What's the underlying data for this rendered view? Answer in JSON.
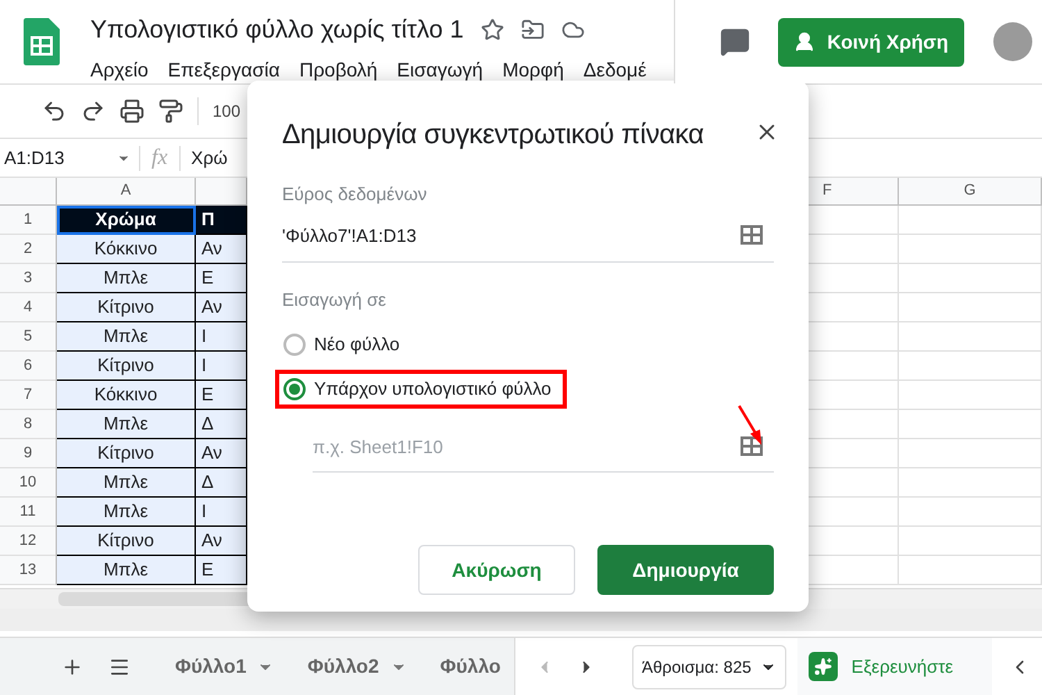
{
  "document": {
    "title": "Υπολογιστικό φύλλο χωρίς τίτλο 1",
    "menu": [
      "Αρχείο",
      "Επεξεργασία",
      "Προβολή",
      "Εισαγωγή",
      "Μορφή",
      "Δεδομέ"
    ]
  },
  "share_button": "Κοινή Χρήση",
  "toolbar": {
    "zoom": "100"
  },
  "formula_bar": {
    "name_box": "A1:D13",
    "fx": "fx",
    "content": "Χρώ"
  },
  "grid": {
    "columns": [
      "A",
      "",
      "",
      "",
      "",
      "F",
      "G"
    ],
    "rows": [
      {
        "number": "1",
        "a": "Χρώμα",
        "b": "Π",
        "header": true
      },
      {
        "number": "2",
        "a": "Κόκκινο",
        "b": "Αν",
        "header": false
      },
      {
        "number": "3",
        "a": "Μπλε",
        "b": "Ε",
        "header": false
      },
      {
        "number": "4",
        "a": "Κίτρινο",
        "b": "Αν",
        "header": false
      },
      {
        "number": "5",
        "a": "Μπλε",
        "b": "Ι",
        "header": false
      },
      {
        "number": "6",
        "a": "Κίτρινο",
        "b": "Ι",
        "header": false
      },
      {
        "number": "7",
        "a": "Κόκκινο",
        "b": "Ε",
        "header": false
      },
      {
        "number": "8",
        "a": "Μπλε",
        "b": "Δ",
        "header": false
      },
      {
        "number": "9",
        "a": "Κίτρινο",
        "b": "Αν",
        "header": false
      },
      {
        "number": "10",
        "a": "Μπλε",
        "b": "Δ",
        "header": false
      },
      {
        "number": "11",
        "a": "Μπλε",
        "b": "Ι",
        "header": false
      },
      {
        "number": "12",
        "a": "Κίτρινο",
        "b": "Αν",
        "header": false
      },
      {
        "number": "13",
        "a": "Μπλε",
        "b": "Ε",
        "header": false
      }
    ]
  },
  "dialog": {
    "title": "Δημιουργία συγκεντρωτικού πίνακα",
    "range_label": "Εύρος δεδομένων",
    "range_value": "'Φύλλο7'!A1:D13",
    "insert_label": "Εισαγωγή σε",
    "options": [
      {
        "label": "Νέο φύλλο",
        "selected": false,
        "highlighted": false
      },
      {
        "label": "Υπάρχον υπολογιστικό φύλλο",
        "selected": true,
        "highlighted": true
      }
    ],
    "location_placeholder": "π.χ. Sheet1!F10",
    "cancel": "Ακύρωση",
    "create": "Δημιουργία"
  },
  "sheet_tabs": [
    {
      "label": "Φύλλο1"
    },
    {
      "label": "Φύλλο2"
    },
    {
      "label": "Φύλλο"
    }
  ],
  "sum": "Άθροισμα: 825",
  "explore": "Εξερευνήστε"
}
